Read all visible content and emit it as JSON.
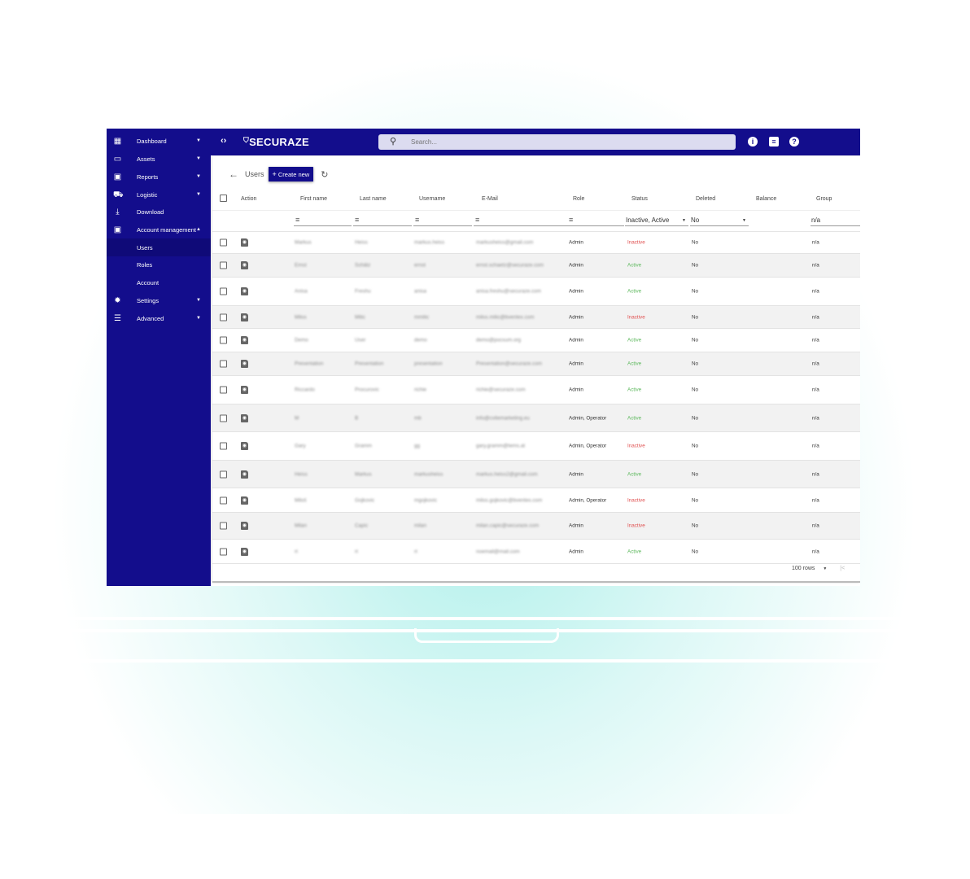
{
  "sidebar": {
    "items": [
      {
        "label": "Dashboard",
        "icon": "dashboard-icon",
        "caret": "▼"
      },
      {
        "label": "Assets",
        "icon": "devices-icon",
        "caret": "▼"
      },
      {
        "label": "Reports",
        "icon": "pdf-icon",
        "caret": "▼"
      },
      {
        "label": "Logistic",
        "icon": "truck-icon",
        "caret": "▼"
      },
      {
        "label": "Download",
        "icon": "download-icon",
        "caret": ""
      },
      {
        "label": "Account management",
        "icon": "account-box-icon",
        "caret": "▲"
      },
      {
        "label": "Users",
        "icon": "",
        "caret": "",
        "selected": true
      },
      {
        "label": "Roles",
        "icon": "",
        "caret": ""
      },
      {
        "label": "Account",
        "icon": "",
        "caret": ""
      },
      {
        "label": "Settings",
        "icon": "gear-icon",
        "caret": "▼"
      },
      {
        "label": "Advanced",
        "icon": "sliders-icon",
        "caret": "▼"
      }
    ]
  },
  "header": {
    "toggle": "‹›",
    "brand": "SECURAZE",
    "search_placeholder": "Search..."
  },
  "page": {
    "title": "Users",
    "create_label": "Create new"
  },
  "table": {
    "columns": [
      "Action",
      "First name",
      "Last name",
      "Username",
      "E-Mail",
      "Role",
      "Status",
      "Deleted",
      "Balance",
      "Group"
    ],
    "filters": {
      "status": "Inactive, Active",
      "deleted": "No",
      "group": "n/a"
    },
    "rows": [
      [
        "Markus",
        "Heiss",
        "markus.heiss",
        "markusheiss@gmail.com",
        "Admin",
        "Inactive",
        "No",
        "",
        "n/a"
      ],
      [
        "Ernst",
        "Schätz",
        "ernst",
        "ernst.schaetz@securaze.com",
        "Admin",
        "Active",
        "No",
        "",
        "n/a"
      ],
      [
        "Anisa",
        "Freshu",
        "anisa",
        "anisa.freshu@securaze.com",
        "Admin",
        "Active",
        "No",
        "",
        "n/a"
      ],
      [
        "Milos",
        "Mitic",
        "mmitic",
        "milos.mitic@bventex.com",
        "Admin",
        "Inactive",
        "No",
        "",
        "n/a"
      ],
      [
        "Demo",
        "User",
        "demo",
        "demo@pocsum.org",
        "Admin",
        "Active",
        "No",
        "",
        "n/a"
      ],
      [
        "Presentation",
        "Presentation",
        "presentation",
        "Presentation@securaze.com",
        "Admin",
        "Active",
        "No",
        "",
        "n/a"
      ],
      [
        "Riccardo",
        "Procurovic",
        "richie",
        "richie@securaze.com",
        "Admin",
        "Active",
        "No",
        "",
        "n/a"
      ],
      [
        "M",
        "B",
        "mb",
        "info@cvitemarketing.eu",
        "Admin, Operator",
        "Active",
        "No",
        "",
        "n/a"
      ],
      [
        "Gary",
        "Gramm",
        "gg",
        "gary.gramm@tems.at",
        "Admin, Operator",
        "Inactive",
        "No",
        "",
        "n/a"
      ],
      [
        "Heiss",
        "Markus",
        "markusheiss",
        "markus.heiss2@gmail.com",
        "Admin",
        "Active",
        "No",
        "",
        "n/a"
      ],
      [
        "Miloš",
        "Gojkovic",
        "mgojkovic",
        "milos.gojkovic@bventex.com",
        "Admin, Operator",
        "Inactive",
        "No",
        "",
        "n/a"
      ],
      [
        "Milan",
        "Capic",
        "milan",
        "milan.capic@securaze.com",
        "Admin",
        "Inactive",
        "No",
        "",
        "n/a"
      ],
      [
        "rt",
        "rt",
        "rt",
        "noemail@mail.com",
        "Admin",
        "Active",
        "No",
        "",
        "n/a"
      ]
    ]
  },
  "pagination": {
    "rows_per_page": "100 rows",
    "first_page": "|<"
  },
  "colors": {
    "primary": "#130d8c",
    "active": "#5cb85c",
    "inactive": "#e05050"
  }
}
